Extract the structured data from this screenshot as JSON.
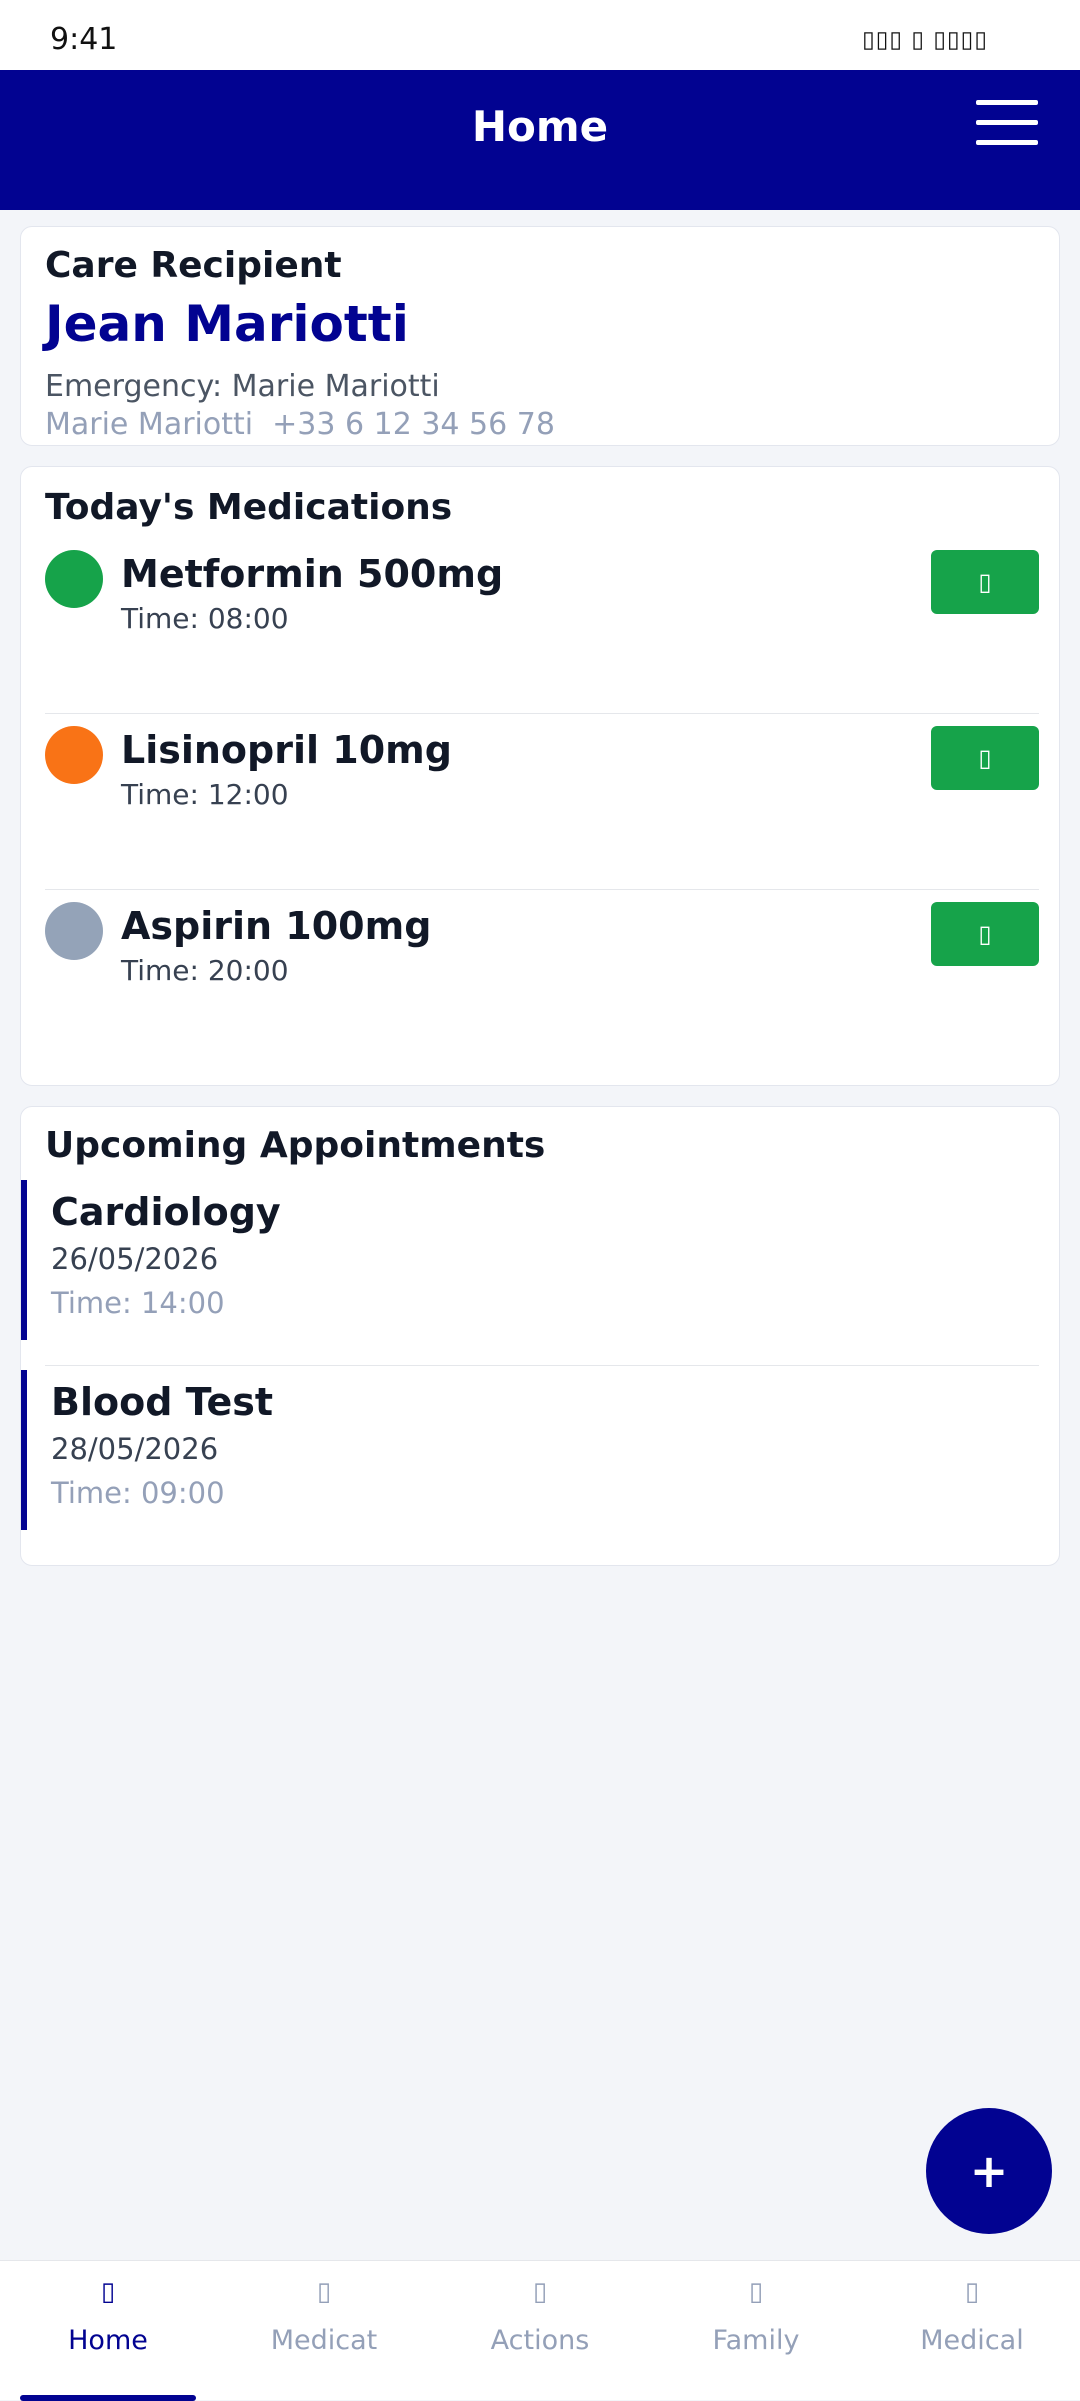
{
  "status_bar": {
    "time": "9:41",
    "icons": "▯▯▯ ▯ ▯▯▯▯"
  },
  "header": {
    "title": "Home"
  },
  "care_recipient": {
    "title": "Care Recipient",
    "name": "Jean Mariotti",
    "emergency_label": "Emergency: Marie Mariotti",
    "emergency_contact": "Marie Mariotti  +33 6 12 34 56 78"
  },
  "medications": {
    "title": "Today's Medications",
    "items": [
      {
        "name": "Metformin 500mg",
        "time": "Time: 08:00",
        "color": "#16a34a",
        "check": "▯"
      },
      {
        "name": "Lisinopril 10mg",
        "time": "Time: 12:00",
        "color": "#f97316",
        "check": "▯"
      },
      {
        "name": "Aspirin 100mg",
        "time": "Time: 20:00",
        "color": "#94a3b8",
        "check": "▯"
      }
    ]
  },
  "appointments": {
    "title": "Upcoming Appointments",
    "items": [
      {
        "title": "Cardiology",
        "date": "26/05/2026",
        "time": "Time: 14:00"
      },
      {
        "title": "Blood Test",
        "date": "28/05/2026",
        "time": "Time: 09:00"
      }
    ]
  },
  "fab": {
    "label": "+"
  },
  "bottom_nav": {
    "items": [
      {
        "label": "Home",
        "icon": "▯",
        "active": true
      },
      {
        "label": "Medicat",
        "icon": "▯",
        "active": false
      },
      {
        "label": "Actions",
        "icon": "▯",
        "active": false
      },
      {
        "label": "Family",
        "icon": "▯",
        "active": false
      },
      {
        "label": "Medical",
        "icon": "▯",
        "active": false
      }
    ]
  },
  "colors": {
    "primary": "#020391",
    "success": "#16a34a",
    "background": "#f3f5f9"
  }
}
